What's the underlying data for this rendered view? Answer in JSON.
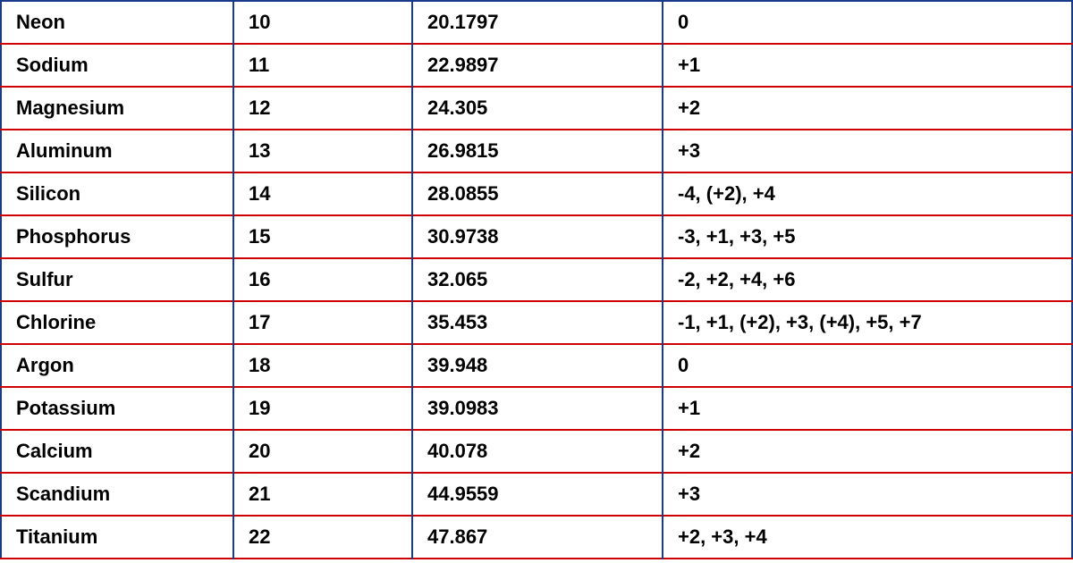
{
  "table": {
    "rows": [
      {
        "name": "Neon",
        "number": "10",
        "weight": "20.1797",
        "oxidation": "0"
      },
      {
        "name": "Sodium",
        "number": "11",
        "weight": "22.9897",
        "oxidation": "+1"
      },
      {
        "name": "Magnesium",
        "number": "12",
        "weight": "24.305",
        "oxidation": "+2"
      },
      {
        "name": "Aluminum",
        "number": "13",
        "weight": "26.9815",
        "oxidation": "+3"
      },
      {
        "name": "Silicon",
        "number": "14",
        "weight": "28.0855",
        "oxidation": "-4, (+2), +4"
      },
      {
        "name": "Phosphorus",
        "number": "15",
        "weight": "30.9738",
        "oxidation": "-3, +1, +3, +5"
      },
      {
        "name": "Sulfur",
        "number": "16",
        "weight": "32.065",
        "oxidation": "-2, +2, +4, +6"
      },
      {
        "name": "Chlorine",
        "number": "17",
        "weight": "35.453",
        "oxidation": "-1, +1, (+2), +3, (+4), +5, +7"
      },
      {
        "name": "Argon",
        "number": "18",
        "weight": "39.948",
        "oxidation": "0"
      },
      {
        "name": "Potassium",
        "number": "19",
        "weight": "39.0983",
        "oxidation": "+1"
      },
      {
        "name": "Calcium",
        "number": "20",
        "weight": "40.078",
        "oxidation": "+2"
      },
      {
        "name": "Scandium",
        "number": "21",
        "weight": "44.9559",
        "oxidation": "+3"
      },
      {
        "name": "Titanium",
        "number": "22",
        "weight": "47.867",
        "oxidation": "+2, +3, +4"
      }
    ]
  }
}
